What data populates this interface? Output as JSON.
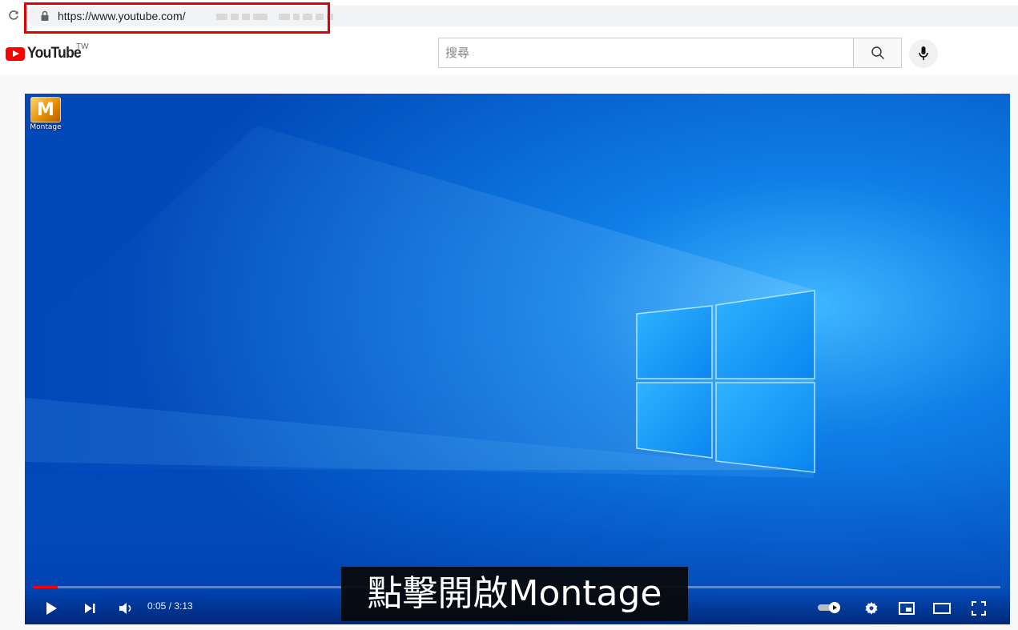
{
  "browser": {
    "url": "https://www.youtube.com/",
    "reload_icon": "reload-icon",
    "lock_icon": "lock-icon"
  },
  "header": {
    "logo_text": "YouTube",
    "country_code": "TW",
    "search_placeholder": "搜尋",
    "search_icon": "search-icon",
    "mic_icon": "microphone-icon"
  },
  "player": {
    "desktop_icon_letter": "M",
    "desktop_icon_label": "Montage",
    "subtitle": "點擊開啟Montage",
    "current_time": "0:05",
    "duration": "3:13",
    "time_display": "0:05 / 3:13",
    "progress": 0.026,
    "controls": {
      "play_icon": "play-icon",
      "next_icon": "next-icon",
      "volume_icon": "volume-icon",
      "autoplay_icon": "autoplay-toggle-icon",
      "settings_icon": "settings-icon",
      "miniplayer_icon": "miniplayer-icon",
      "theater_icon": "theater-mode-icon",
      "fullscreen_icon": "fullscreen-icon"
    }
  },
  "colors": {
    "accent": "#ff0000",
    "highlight_box": "#e00000",
    "video_bg": "#0050c8"
  }
}
